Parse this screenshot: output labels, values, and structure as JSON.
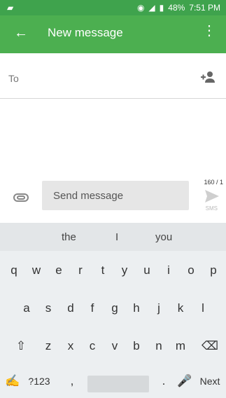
{
  "status": {
    "battery": "48%",
    "time": "7:51 PM"
  },
  "app": {
    "title": "New message"
  },
  "to": {
    "label": "To"
  },
  "compose": {
    "placeholder": "Send message",
    "counter": "160 / 1",
    "sms": "SMS"
  },
  "keyboard": {
    "suggestions": [
      "the",
      "I",
      "you"
    ],
    "row1": [
      "q",
      "w",
      "e",
      "r",
      "t",
      "y",
      "u",
      "i",
      "o",
      "p"
    ],
    "row2": [
      "a",
      "s",
      "d",
      "f",
      "g",
      "h",
      "j",
      "k",
      "l"
    ],
    "row3": [
      "z",
      "x",
      "c",
      "v",
      "b",
      "n",
      "m"
    ],
    "symbols": "?123",
    "comma": ",",
    "period": ".",
    "next": "Next"
  }
}
